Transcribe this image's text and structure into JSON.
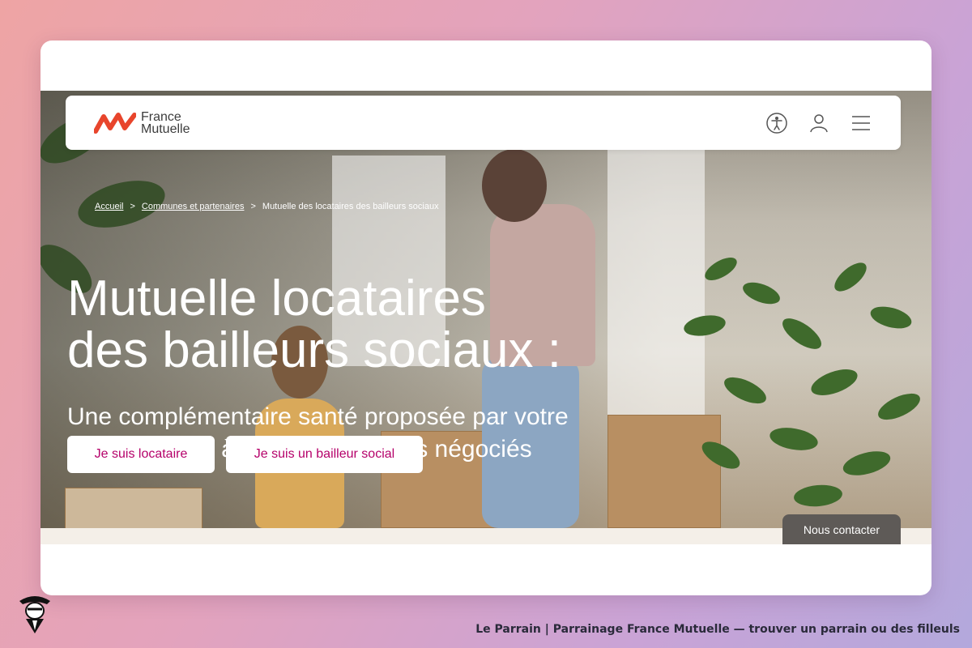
{
  "header": {
    "logo_line1": "France",
    "logo_line2": "Mutuelle",
    "icons": [
      "accessibility-icon",
      "user-icon",
      "menu-icon"
    ]
  },
  "breadcrumb": {
    "items": [
      "Accueil",
      "Communes et partenaires",
      "Mutuelle des locataires des bailleurs sociaux"
    ],
    "separator": ">"
  },
  "hero": {
    "title_line1": "Mutuelle locataires",
    "title_line2": "des bailleurs sociaux :",
    "subtitle_line1": "Une complémentaire santé proposée par votre",
    "subtitle_line2": "bailleur social à tarifs et garanties négociés",
    "button_tenant": "Je suis locataire",
    "button_landlord": "Je suis un bailleur social"
  },
  "contact": {
    "label": "Nous contacter"
  },
  "footer": {
    "caption": "Le Parrain | Parrainage France Mutuelle — trouver un parrain ou des filleuls"
  },
  "colors": {
    "brand_red": "#e8452c",
    "button_text": "#b5006a",
    "contact_bg": "#5e5a57"
  }
}
